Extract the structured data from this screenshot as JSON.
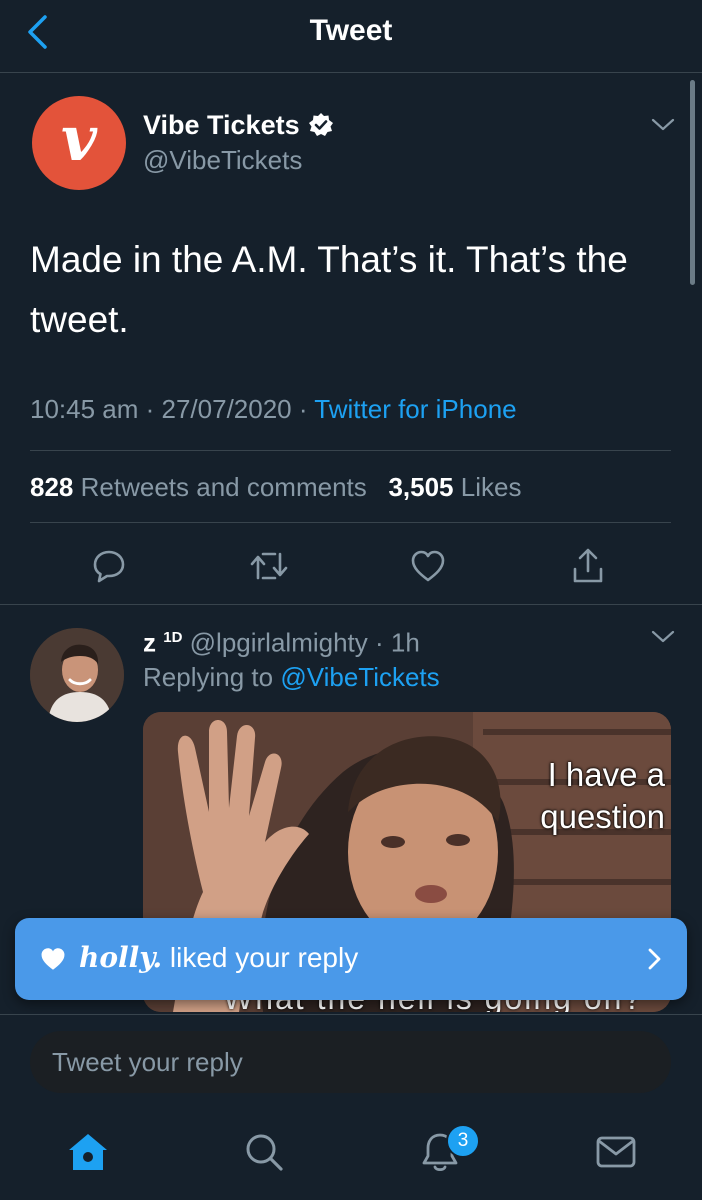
{
  "header": {
    "title": "Tweet"
  },
  "tweet": {
    "author_name": "Vibe Tickets",
    "author_handle": "@VibeTickets",
    "avatar_letter": "v",
    "text": "Made in the A.M. That’s it. That’s the tweet.",
    "time": "10:45 am",
    "date": "27/07/2020",
    "source": "Twitter for iPhone",
    "retweets_count": "828",
    "retweets_label": "Retweets and comments",
    "likes_count": "3,505",
    "likes_label": "Likes"
  },
  "reply": {
    "author_name": "z",
    "author_sup": "1D",
    "author_handle": "@lpgirlalmighty",
    "age": "1h",
    "replying_label": "Replying to",
    "replying_to": "@VibeTickets",
    "media_text": "I have a question",
    "media_bottom_text": "What the hell is going on?"
  },
  "toast": {
    "user": "holly.",
    "message": "liked your reply"
  },
  "composer": {
    "placeholder": "Tweet your reply"
  },
  "tabbar": {
    "notifications_badge": "3"
  },
  "colors": {
    "background": "#15202b",
    "accent": "#1da1f2",
    "toast": "#4a99e9",
    "brand": "#e3533a"
  }
}
